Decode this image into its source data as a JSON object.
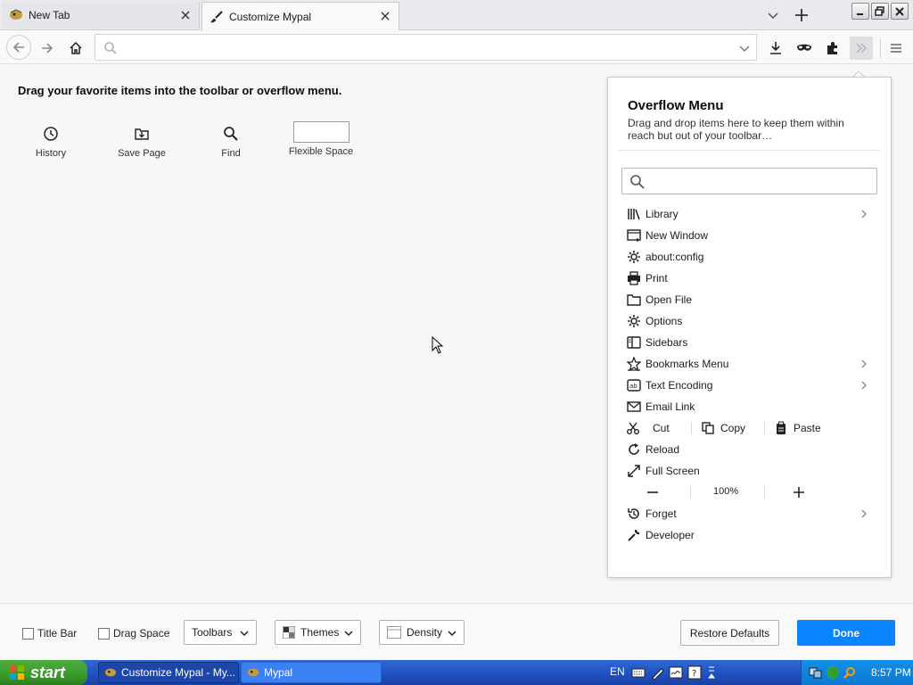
{
  "tabs": [
    {
      "title": "New Tab"
    },
    {
      "title": "Customize Mypal"
    }
  ],
  "customize": {
    "header": "Drag your favorite items into the toolbar or overflow menu.",
    "palette": [
      "History",
      "Save Page",
      "Find",
      "Flexible Space"
    ]
  },
  "overflow": {
    "title": "Overflow Menu",
    "description": "Drag and drop items here to keep them within reach but out of your toolbar…",
    "search_placeholder": "",
    "items": [
      {
        "label": "Library",
        "icon": "library-icon",
        "submenu": true
      },
      {
        "label": "New Window",
        "icon": "new-window-icon",
        "submenu": false
      },
      {
        "label": "about:config",
        "icon": "gear-icon",
        "submenu": false
      },
      {
        "label": "Print",
        "icon": "printer-icon",
        "submenu": false
      },
      {
        "label": "Open File",
        "icon": "folder-icon",
        "submenu": false
      },
      {
        "label": "Options",
        "icon": "gear-icon",
        "submenu": false
      },
      {
        "label": "Sidebars",
        "icon": "sidebar-icon",
        "submenu": false
      },
      {
        "label": "Bookmarks Menu",
        "icon": "star-icon",
        "submenu": true
      },
      {
        "label": "Text Encoding",
        "icon": "text-encoding-icon",
        "submenu": true
      },
      {
        "label": "Email Link",
        "icon": "envelope-icon",
        "submenu": false
      }
    ],
    "edit": {
      "cut": "Cut",
      "copy": "Copy",
      "paste": "Paste"
    },
    "items2": [
      {
        "label": "Reload",
        "icon": "reload-icon"
      },
      {
        "label": "Full Screen",
        "icon": "fullscreen-icon"
      }
    ],
    "zoom": "100%",
    "items3": [
      {
        "label": "Forget",
        "icon": "forget-icon",
        "submenu": true
      },
      {
        "label": "Developer",
        "icon": "wrench-icon",
        "submenu": false
      }
    ]
  },
  "bottom": {
    "title_bar": "Title Bar",
    "drag_space": "Drag Space",
    "toolbars": "Toolbars",
    "themes": "Themes",
    "density": "Density",
    "restore": "Restore Defaults",
    "done": "Done"
  },
  "taskbar": {
    "start": "start",
    "tasks": [
      "Customize Mypal - My...",
      "Mypal"
    ],
    "lang": "EN",
    "clock": "8:57 PM"
  },
  "colors": {
    "accent": "#0a84ff",
    "taskbar": "#245edb",
    "start": "#3a9a2b"
  }
}
